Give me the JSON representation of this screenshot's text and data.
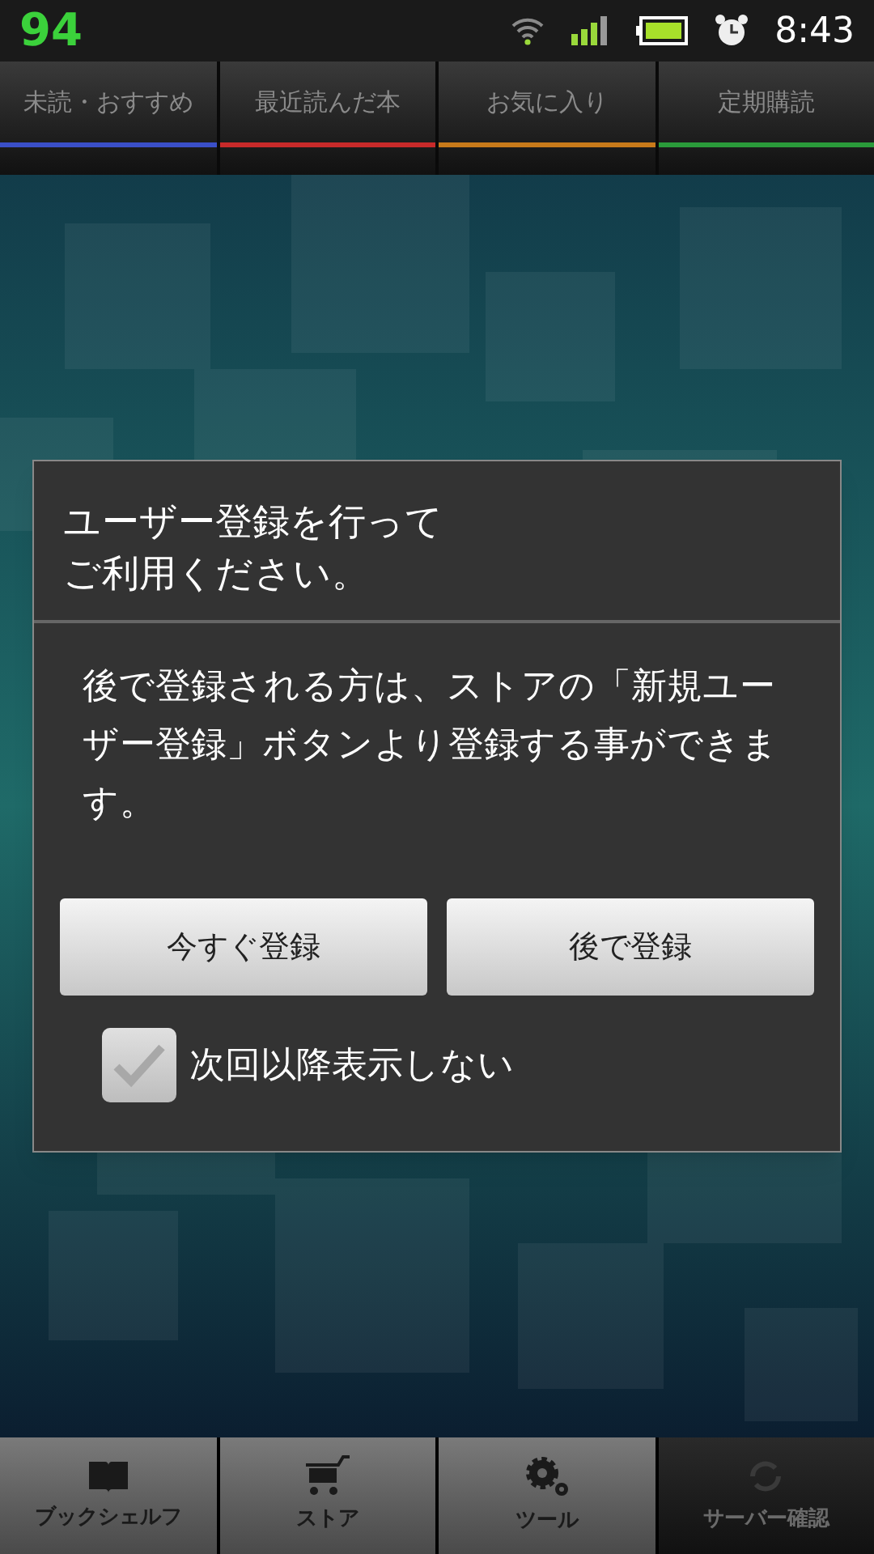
{
  "status_bar": {
    "badge": "94",
    "time": "8:43"
  },
  "tabs": [
    {
      "label": "未読・おすすめ",
      "color": "#3a4fc8"
    },
    {
      "label": "最近読んだ本",
      "color": "#c82a2a"
    },
    {
      "label": "お気に入り",
      "color": "#c87a1a"
    },
    {
      "label": "定期購読",
      "color": "#2a9a3a"
    }
  ],
  "dialog": {
    "title_lines": [
      "ユーザー登録を行って",
      "ご利用ください。"
    ],
    "message": "後で登録される方は、ストアの「新規ユーザー登録」ボタンより登録する事ができます。",
    "buttons": [
      "今すぐ登録",
      "後で登録"
    ],
    "checkbox": {
      "label": "次回以降表示しない",
      "checked": false
    }
  },
  "bottom_nav": [
    {
      "label": "ブックシェルフ",
      "kind": "book",
      "disabled": false
    },
    {
      "label": "ストア",
      "kind": "cart",
      "disabled": false
    },
    {
      "label": "ツール",
      "kind": "gear",
      "disabled": false
    },
    {
      "label": "サーバー確認",
      "kind": "sync",
      "disabled": true
    }
  ]
}
